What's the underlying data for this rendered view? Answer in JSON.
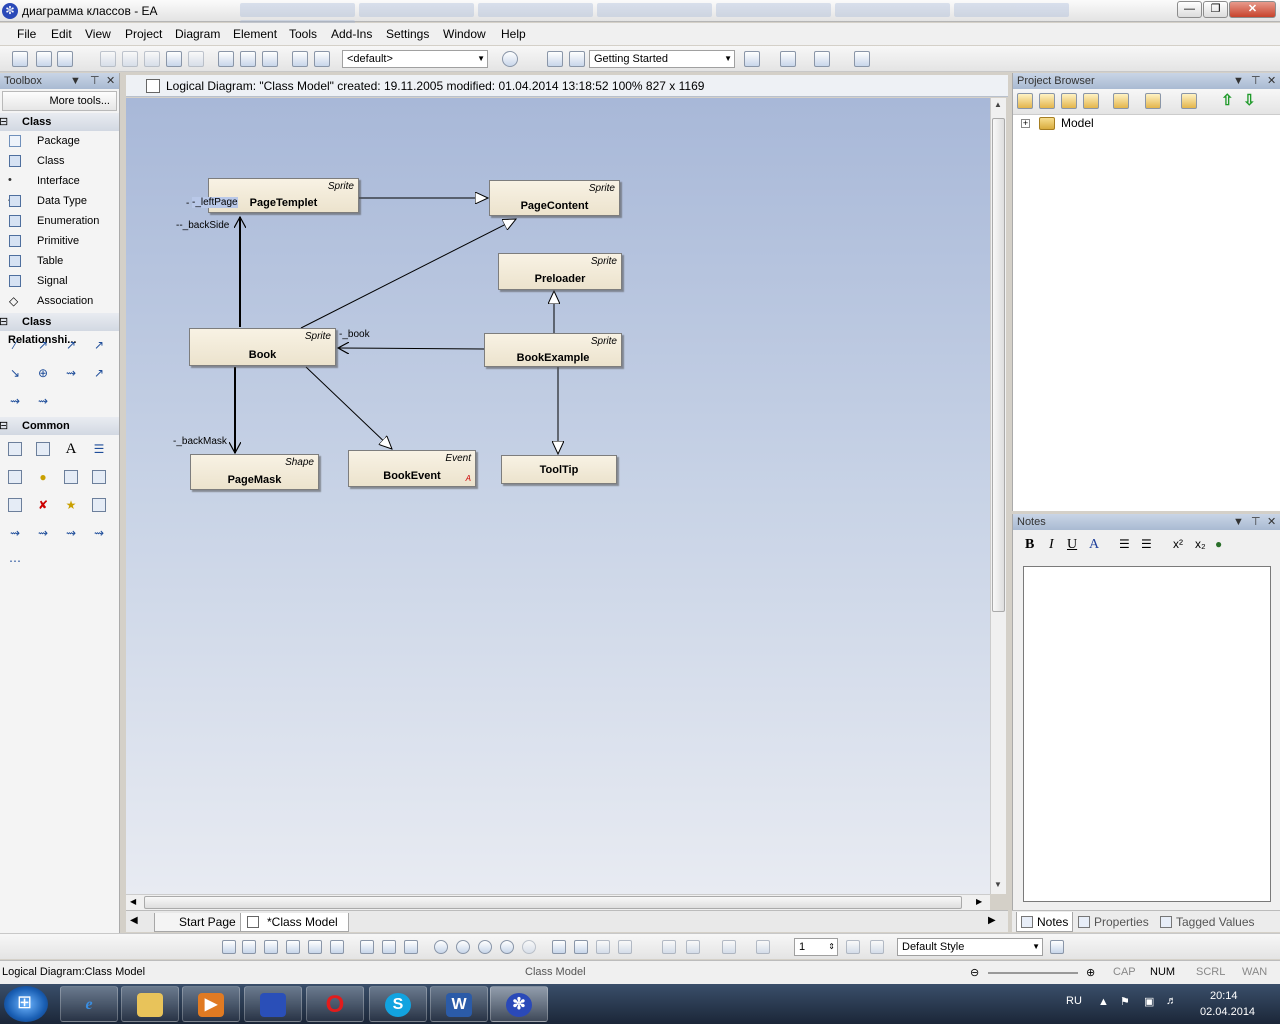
{
  "window": {
    "title": "диаграмма классов - EA",
    "min_label": "—",
    "max_label": "❐",
    "close_label": "✕"
  },
  "menu": [
    "File",
    "Edit",
    "View",
    "Project",
    "Diagram",
    "Element",
    "Tools",
    "Add-Ins",
    "Settings",
    "Window",
    "Help"
  ],
  "toolbar": {
    "style_combo": "<default>",
    "workspace_combo": "Getting Started"
  },
  "toolbox": {
    "title": "Toolbox",
    "more_tools": "More tools...",
    "class_section": "Class",
    "class_items": [
      "Package",
      "Class",
      "Interface",
      "Data Type",
      "Enumeration",
      "Primitive",
      "Table",
      "Signal",
      "Association"
    ],
    "relationships_section": "Class Relationshi...",
    "common_section": "Common"
  },
  "diagram": {
    "header": "Logical Diagram: \"Class Model\"   created: 19.11.2005  modified: 01.04.2014 13:18:52   100%   827 x 1169",
    "classes": {
      "page_templet": {
        "stereotype": "Sprite",
        "name": "PageTemplet"
      },
      "page_content": {
        "stereotype": "Sprite",
        "name": "PageContent"
      },
      "preloader": {
        "stereotype": "Sprite",
        "name": "Preloader"
      },
      "book": {
        "stereotype": "Sprite",
        "name": "Book"
      },
      "book_example": {
        "stereotype": "Sprite",
        "name": "BookExample"
      },
      "page_mask": {
        "stereotype": "Shape",
        "name": "PageMask"
      },
      "book_event": {
        "stereotype": "Event",
        "name": "BookEvent",
        "flag": "A"
      },
      "tool_tip": {
        "stereotype": "",
        "name": "ToolTip"
      }
    },
    "roles": {
      "left_page": "-_leftPage",
      "back_side": "--_backSide",
      "book": "-_book",
      "back_mask": "-_backMask"
    },
    "tabs": [
      "Start Page",
      "*Class Model"
    ]
  },
  "project_browser": {
    "title": "Project Browser",
    "root": "Model"
  },
  "notes": {
    "title": "Notes",
    "tabs": [
      "Notes",
      "Properties",
      "Tagged Values"
    ]
  },
  "bottom_toolbar": {
    "line_width": "1",
    "style": "Default Style"
  },
  "status": {
    "left": "Logical Diagram:Class Model",
    "center": "Class Model",
    "indicators": [
      "CAP",
      "NUM",
      "SCRL",
      "WAN"
    ]
  },
  "taskbar": {
    "language": "RU",
    "time": "20:14",
    "date": "02.04.2014"
  }
}
